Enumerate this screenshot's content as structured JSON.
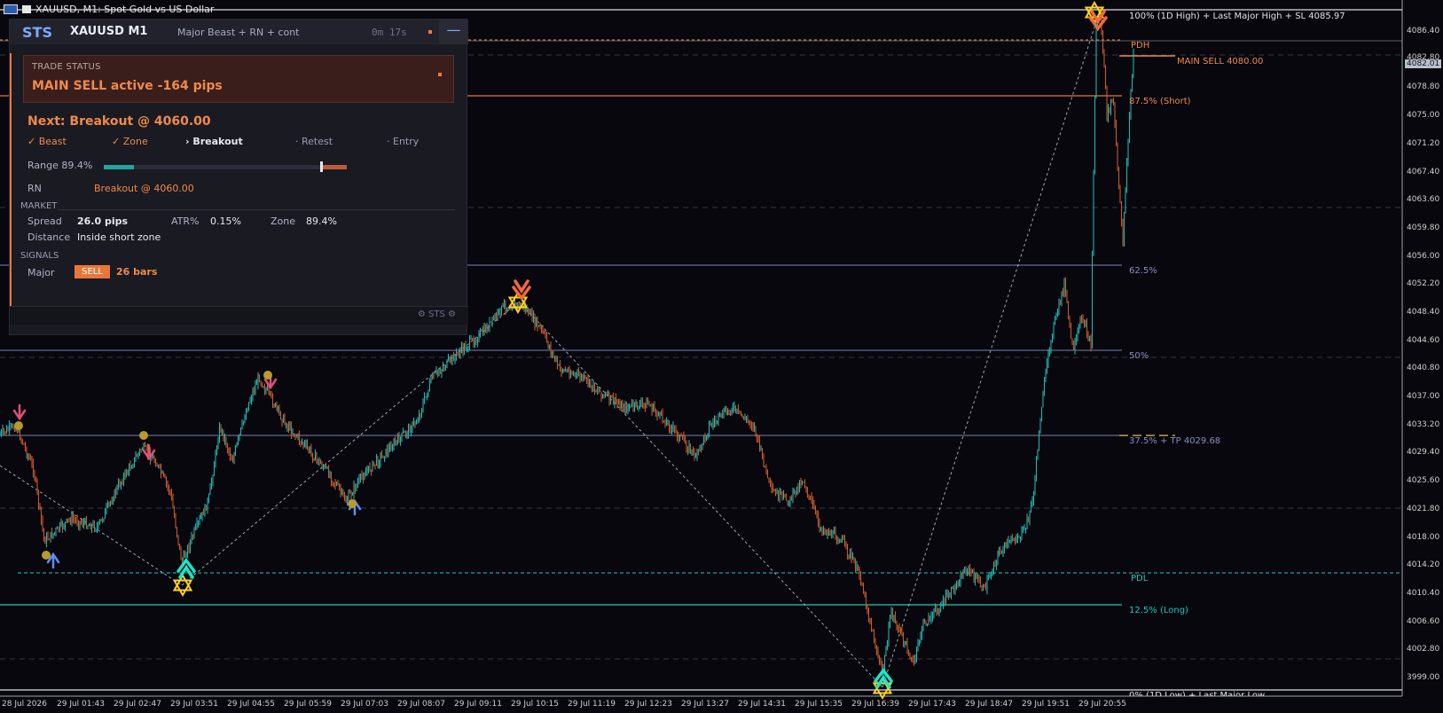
{
  "window": {
    "title": "XAUUSD, M1:  Spot Gold vs US Dollar"
  },
  "colors": {
    "background": "#07070d",
    "bull": "#1fb5b0",
    "bear": "#c65a2e",
    "accent_orange": "#f08a4a",
    "teal_line": "#1fc8b8",
    "lavender_line": "#7e7fb8"
  },
  "price_axis": {
    "current_price": "4082.01",
    "labels": [
      "4086.40",
      "4082.80",
      "4078.80",
      "4075.00",
      "4071.20",
      "4067.40",
      "4063.60",
      "4059.80",
      "4056.00",
      "4052.20",
      "4048.40",
      "4044.60",
      "4040.80",
      "4037.00",
      "4033.20",
      "4029.40",
      "4025.60",
      "4021.80",
      "4018.00",
      "4014.20",
      "4010.40",
      "4006.60",
      "4002.80",
      "3999.00"
    ]
  },
  "time_axis": {
    "labels": [
      "28 Jul 2026",
      "29 Jul 01:43",
      "29 Jul 02:47",
      "29 Jul 03:51",
      "29 Jul 04:55",
      "29 Jul 05:59",
      "29 Jul 07:03",
      "29 Jul 08:07",
      "29 Jul 09:11",
      "29 Jul 10:15",
      "29 Jul 11:19",
      "29 Jul 12:23",
      "29 Jul 13:27",
      "29 Jul 14:31",
      "29 Jul 15:35",
      "29 Jul 16:39",
      "29 Jul 17:43",
      "29 Jul 18:47",
      "29 Jul 19:51",
      "29 Jul 20:55"
    ]
  },
  "levels": {
    "high": "100% (1D High) + Last Major High + SL 4085.97",
    "pdh": "PDH",
    "main_sell": "MAIN SELL 4080.00",
    "l875": "87.5% (Short)",
    "l625": "62.5%",
    "l50": "50%",
    "l375": "37.5% + TP 4029.68",
    "pdl": "PDL",
    "l125": "12.5% (Long)",
    "low": "0% (1D Low) + Last Major Low"
  },
  "panel": {
    "logo": "STS",
    "symbol": "XAUUSD M1",
    "subtitle": "Major Beast + RN + cont",
    "timer": "0m 17s",
    "minimize": "—",
    "trade_status_label": "TRADE STATUS",
    "trade_status": "MAIN SELL active -164 pips",
    "next": "Next: Breakout @ 4060.00",
    "steps": [
      "✓ Beast",
      "✓ Zone",
      "› Breakout",
      "· Retest",
      "· Entry"
    ],
    "range_label": "Range 89.4%",
    "range_value": 0.894,
    "rn_label": "RN",
    "rn_value": "Breakout @ 4060.00",
    "market_label": "MARKET",
    "spread_label": "Spread",
    "spread_value": "26.0 pips",
    "atr_label": "ATR%",
    "atr_value": "0.15%",
    "zone_label": "Zone",
    "zone_value": "89.4%",
    "distance_label": "Distance",
    "distance_value": "Inside short zone",
    "signals_label": "SIGNALS",
    "major_label": "Major",
    "major_badge": "SELL",
    "major_bars": "26 bars",
    "footer": "⚙ STS ⚙"
  }
}
